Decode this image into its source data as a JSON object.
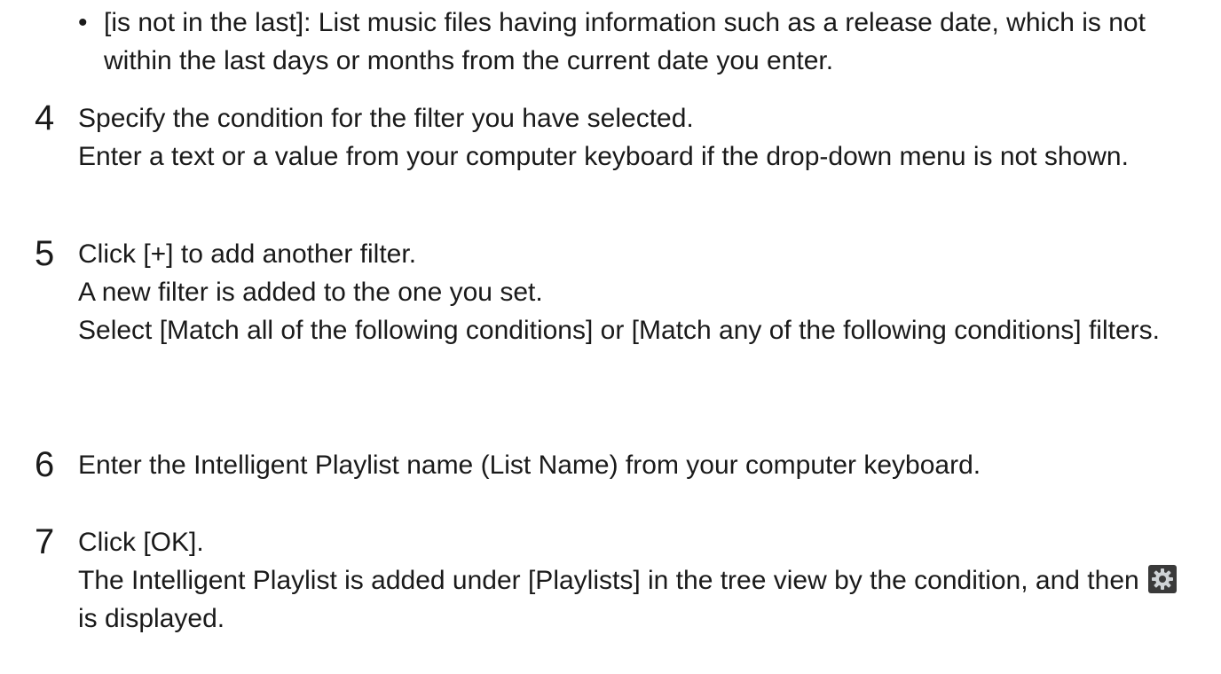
{
  "bullet": {
    "marker": "•",
    "text": "[is not in the last]: List music files having information such as a release date, which is not within the last days or months from the current date you enter."
  },
  "steps": [
    {
      "number": "4",
      "title": "Specify the condition for the filter you have selected.",
      "detail": "Enter a text or a value from your computer keyboard if the drop-down menu is not shown."
    },
    {
      "number": "5",
      "title": "Click [+] to add another filter.",
      "detail_1": "A new filter is added to the one you set.",
      "detail_2": "Select [Match all of the following conditions] or [Match any of the following conditions] filters."
    },
    {
      "number": "6",
      "title": "Enter the Intelligent Playlist name (List Name) from your computer keyboard."
    },
    {
      "number": "7",
      "title": "Click [OK].",
      "detail_before_icon": "The Intelligent Playlist is added under [Playlists] in the tree view by the condition, and then",
      "detail_after_icon": "is displayed.",
      "icon": "intelligent-playlist-gear-icon"
    }
  ],
  "colors": {
    "text": "#1a1a1a",
    "icon_bg": "#3a3a3a",
    "icon_gear": "#cfd3d6"
  }
}
